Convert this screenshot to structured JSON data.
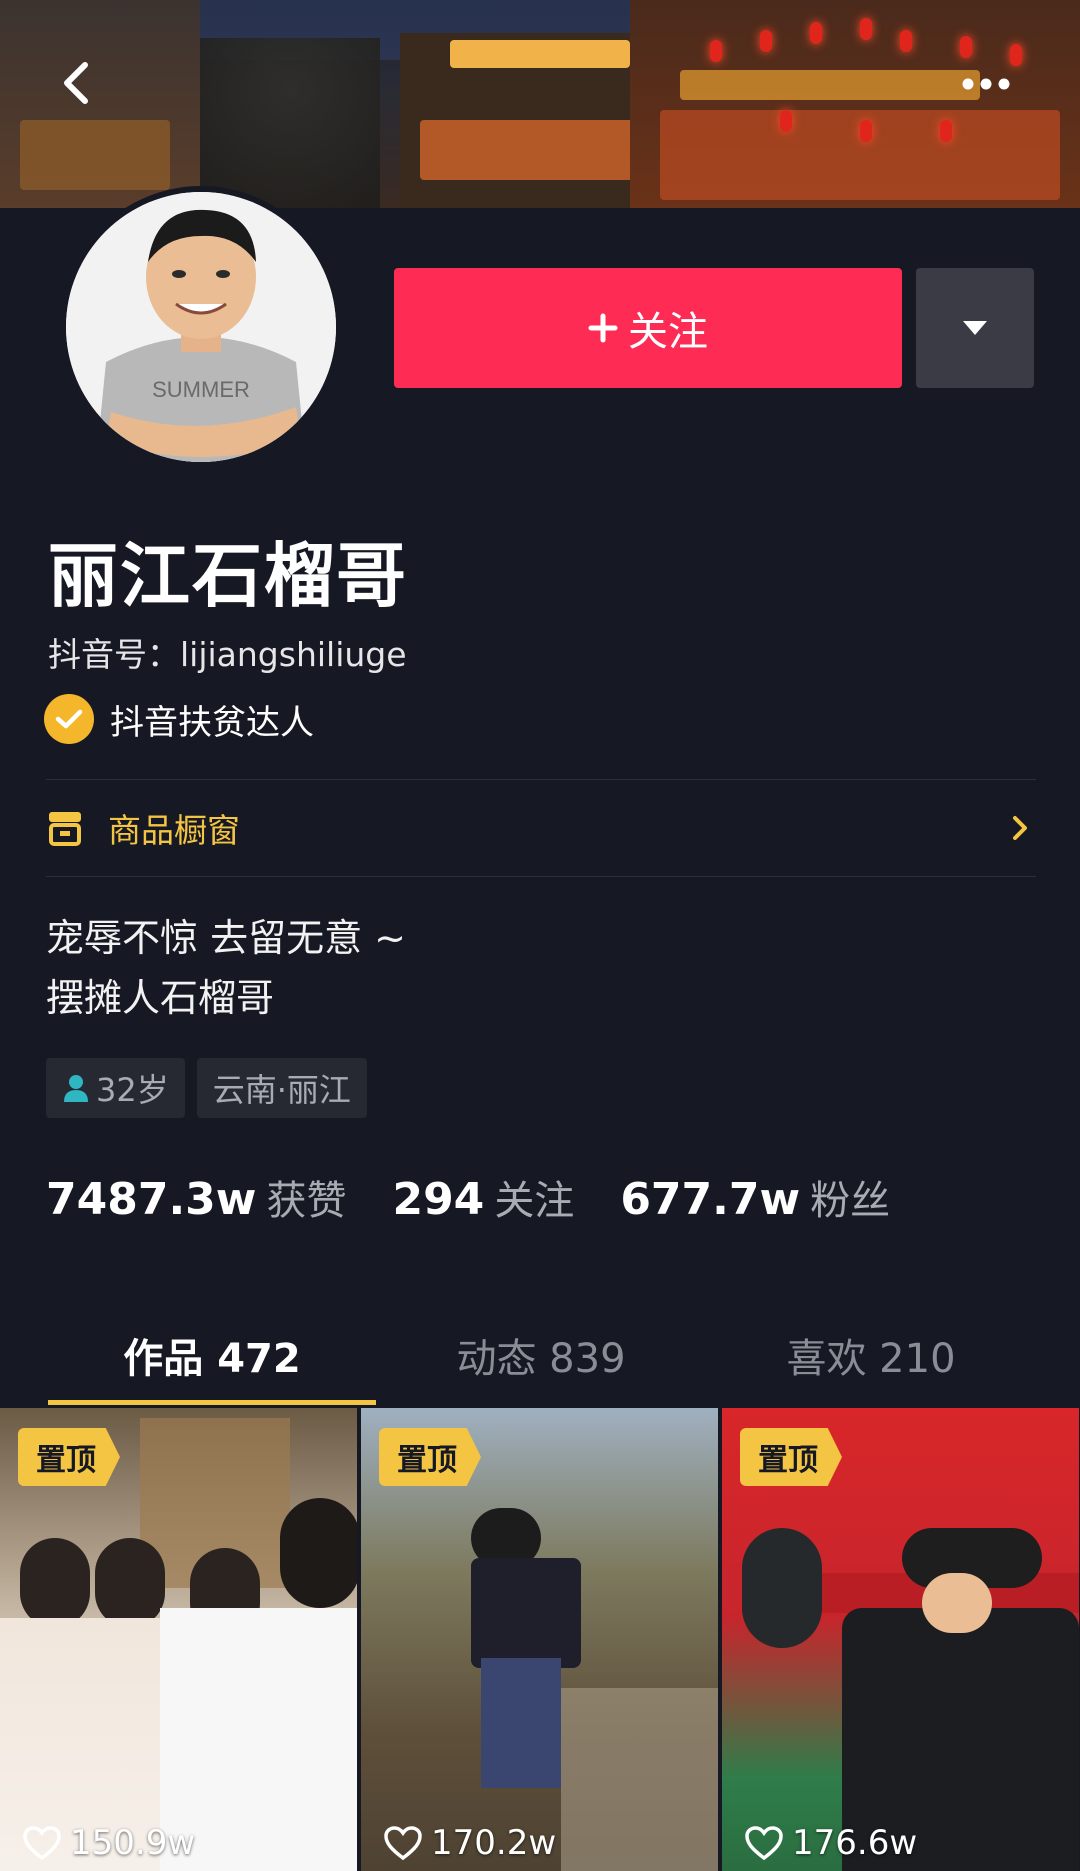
{
  "colors": {
    "background": "#161823",
    "follow": "#fe2c55",
    "accent": "#f4c443",
    "badge": "#f4b62a",
    "muted": "#a9abb3"
  },
  "header": {
    "back_icon": "chevron-left-icon",
    "more_icon": "more-horizontal-icon"
  },
  "profile": {
    "follow_label": "关注",
    "follow_icon": "plus-icon",
    "dropdown_icon": "caret-down-icon",
    "nickname": "丽江石榴哥",
    "douyin_id": "抖音号：lijiangshiliuge",
    "badge_label": "抖音扶贫达人",
    "shop_label": "商品橱窗",
    "bio_line1": "宠辱不惊 去留无意 ~",
    "bio_line2": "摆摊人石榴哥",
    "tags": {
      "age": "32岁",
      "location": "云南·丽江"
    },
    "avatar_print": "SUMMER"
  },
  "stats": {
    "likes": {
      "value": "7487.3w",
      "label": "获赞"
    },
    "following": {
      "value": "294",
      "label": "关注"
    },
    "fans": {
      "value": "677.7w",
      "label": "粉丝"
    }
  },
  "tabs": [
    {
      "label": "作品 472",
      "active": true
    },
    {
      "label": "动态 839",
      "active": false
    },
    {
      "label": "喜欢 210",
      "active": false
    }
  ],
  "videos": [
    {
      "pin": "置顶",
      "likes": "150.9w"
    },
    {
      "pin": "置顶",
      "likes": "170.2w"
    },
    {
      "pin": "置顶",
      "likes": "176.6w"
    }
  ]
}
